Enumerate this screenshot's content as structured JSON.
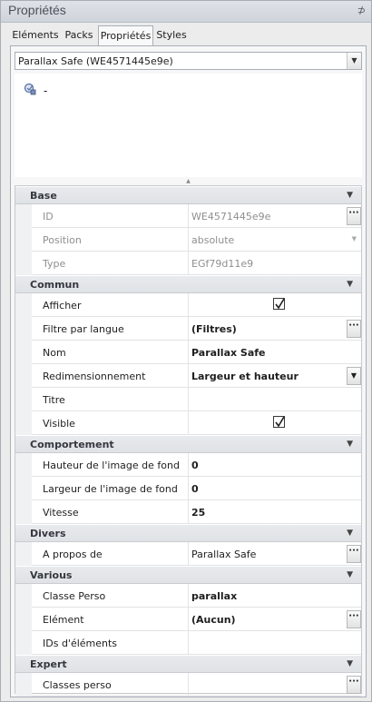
{
  "panel": {
    "title": "Propriétés",
    "pin": "⊅"
  },
  "tabs": [
    {
      "label": "Eléments"
    },
    {
      "label": "Packs"
    },
    {
      "label": "Propriétés"
    },
    {
      "label": "Styles"
    }
  ],
  "selector": {
    "value": "Parallax Safe (WE4571445e9e)"
  },
  "preview": {
    "text": "-"
  },
  "grid": {
    "base": {
      "label": "Base",
      "id": {
        "name": "ID",
        "value": "WE4571445e9e"
      },
      "position": {
        "name": "Position",
        "value": "absolute"
      },
      "type": {
        "name": "Type",
        "value": "EGf79d11e9"
      }
    },
    "commun": {
      "label": "Commun",
      "afficher": {
        "name": "Afficher",
        "checked": true
      },
      "filtre": {
        "name": "Filtre par langue",
        "value": "(Filtres)"
      },
      "nom": {
        "name": "Nom",
        "value": "Parallax Safe"
      },
      "redim": {
        "name": "Redimensionnement",
        "value": "Largeur et hauteur"
      },
      "titre": {
        "name": "Titre",
        "value": ""
      },
      "visible": {
        "name": "Visible",
        "checked": true
      }
    },
    "comportement": {
      "label": "Comportement",
      "hauteur": {
        "name": "Hauteur de l'image de fond",
        "value": "0"
      },
      "largeur": {
        "name": "Largeur de l'image de fond",
        "value": "0"
      },
      "vitesse": {
        "name": "Vitesse",
        "value": "25"
      }
    },
    "divers": {
      "label": "Divers",
      "apropos": {
        "name": "A propos de",
        "value": "Parallax Safe"
      }
    },
    "various": {
      "label": "Various",
      "classe": {
        "name": "Classe Perso",
        "value": "parallax"
      },
      "element": {
        "name": "Elément",
        "value": "(Aucun)"
      },
      "ids": {
        "name": "IDs d'éléments",
        "value": ""
      }
    },
    "expert": {
      "label": "Expert",
      "classes": {
        "name": "Classes perso",
        "value": ""
      }
    }
  },
  "icons": {
    "dots": "···",
    "dropdown": "▼",
    "collapse": "▼",
    "splitter": "▲"
  }
}
